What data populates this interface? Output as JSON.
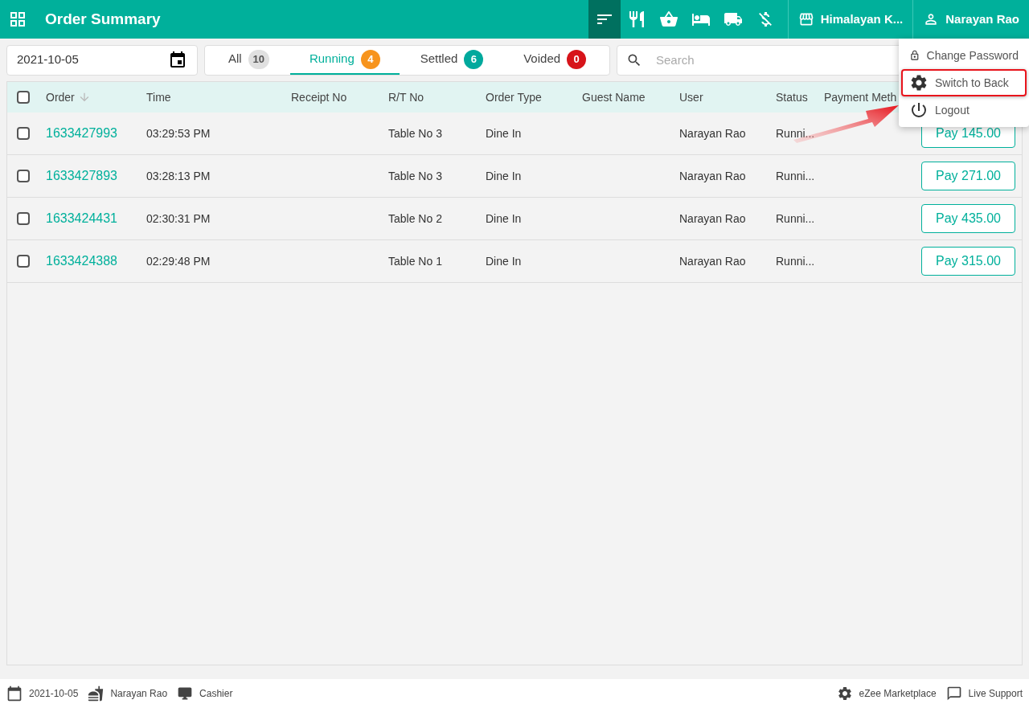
{
  "header": {
    "title": "Order Summary",
    "tools": [
      {
        "kind": "orders",
        "selected": true
      },
      {
        "kind": "dine",
        "selected": false
      },
      {
        "kind": "basket",
        "selected": false
      },
      {
        "kind": "room",
        "selected": false
      },
      {
        "kind": "delivery",
        "selected": false
      },
      {
        "kind": "no-charge",
        "selected": false
      }
    ],
    "outlet": "Himalayan K...",
    "user": "Narayan Rao"
  },
  "user_menu": {
    "items": [
      {
        "kind": "lock",
        "label": "Change Password",
        "highlighted": false
      },
      {
        "kind": "gear",
        "label": "Switch to Back",
        "highlighted": true
      },
      {
        "kind": "power",
        "label": "Logout",
        "highlighted": false
      }
    ]
  },
  "date_field": {
    "value": "2021-10-05"
  },
  "tabs": [
    {
      "label": "All",
      "count": "10",
      "color": "#e0e0e0",
      "selected": false
    },
    {
      "label": "Running",
      "count": "4",
      "color": "#f7941d",
      "selected": true
    },
    {
      "label": "Settled",
      "count": "6",
      "color": "#00a99d",
      "selected": false
    },
    {
      "label": "Voided",
      "count": "0",
      "color": "#d7141a",
      "selected": false
    }
  ],
  "search": {
    "placeholder": "Search"
  },
  "table": {
    "select_all_checked": false,
    "columns": [
      "Order",
      "Time",
      "Receipt No",
      "R/T No",
      "Order Type",
      "Guest Name",
      "User",
      "Status",
      "Payment Meth"
    ],
    "rows": [
      {
        "checked": false,
        "order": "1633427993",
        "time": "03:29:53 PM",
        "rt": "Table No 3",
        "type": "Dine In",
        "user": "Narayan Rao",
        "status": "Runni...",
        "pay": "Pay 145.00"
      },
      {
        "checked": false,
        "order": "1633427893",
        "time": "03:28:13 PM",
        "rt": "Table No 3",
        "type": "Dine In",
        "user": "Narayan Rao",
        "status": "Runni...",
        "pay": "Pay 271.00"
      },
      {
        "checked": false,
        "order": "1633424431",
        "time": "02:30:31 PM",
        "rt": "Table No 2",
        "type": "Dine In",
        "user": "Narayan Rao",
        "status": "Runni...",
        "pay": "Pay 435.00"
      },
      {
        "checked": false,
        "order": "1633424388",
        "time": "02:29:48 PM",
        "rt": "Table No 1",
        "type": "Dine In",
        "user": "Narayan Rao",
        "status": "Runni...",
        "pay": "Pay 315.00"
      }
    ]
  },
  "footer": {
    "date": "2021-10-05",
    "user": "Narayan Rao",
    "role": "Cashier",
    "marketplace": "eZee Marketplace",
    "support": "Live Support"
  }
}
